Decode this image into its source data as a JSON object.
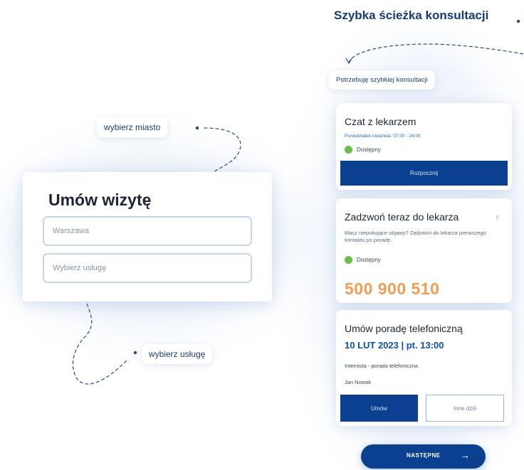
{
  "booking_form": {
    "title": "Umów wizytę",
    "city_placeholder": "Warszawa",
    "service_placeholder": "Wybierz usługę"
  },
  "annotations": {
    "choose_city": "wybierz miasto",
    "choose_service": "wybierz usługę"
  },
  "quick_path": {
    "title": "Szybka ścieżka konsultacji",
    "need_label": "Potrzebuję szybkiej konsultacji"
  },
  "chat_card": {
    "title": "Czat z lekarzem",
    "hours": "Poniedziałek-niedziela: 07:00 - 24:00",
    "status": "Dostępny",
    "button": "Rozpocznij"
  },
  "call_card": {
    "title": "Zadzwoń teraz do lekarza",
    "description": "Masz niepokojące objawy? Zadzwoń do lekarza pierwszego kontaktu po poradę.",
    "status": "Dostępny",
    "phone": "500 900 510",
    "chevron": "›"
  },
  "phone_consult_card": {
    "title": "Umów poradę telefoniczną",
    "date": "10 LUT 2023 | pt. 13:00",
    "specialty": "Internista - porada telefoniczna",
    "doctor": "Jan Nowak",
    "book_button": "Umów",
    "other_button": "Inne dziś"
  },
  "next_button": {
    "label": "NASTĘPNE",
    "arrow": "→"
  },
  "colors": {
    "primary": "#0b3f8f",
    "title_blue": "#163a78",
    "available_green": "#6cbf42",
    "phone_orange": "#ef9e52"
  },
  "icons": [
    "status-dot-icon",
    "chevron-right-icon",
    "arrow-right-icon"
  ]
}
